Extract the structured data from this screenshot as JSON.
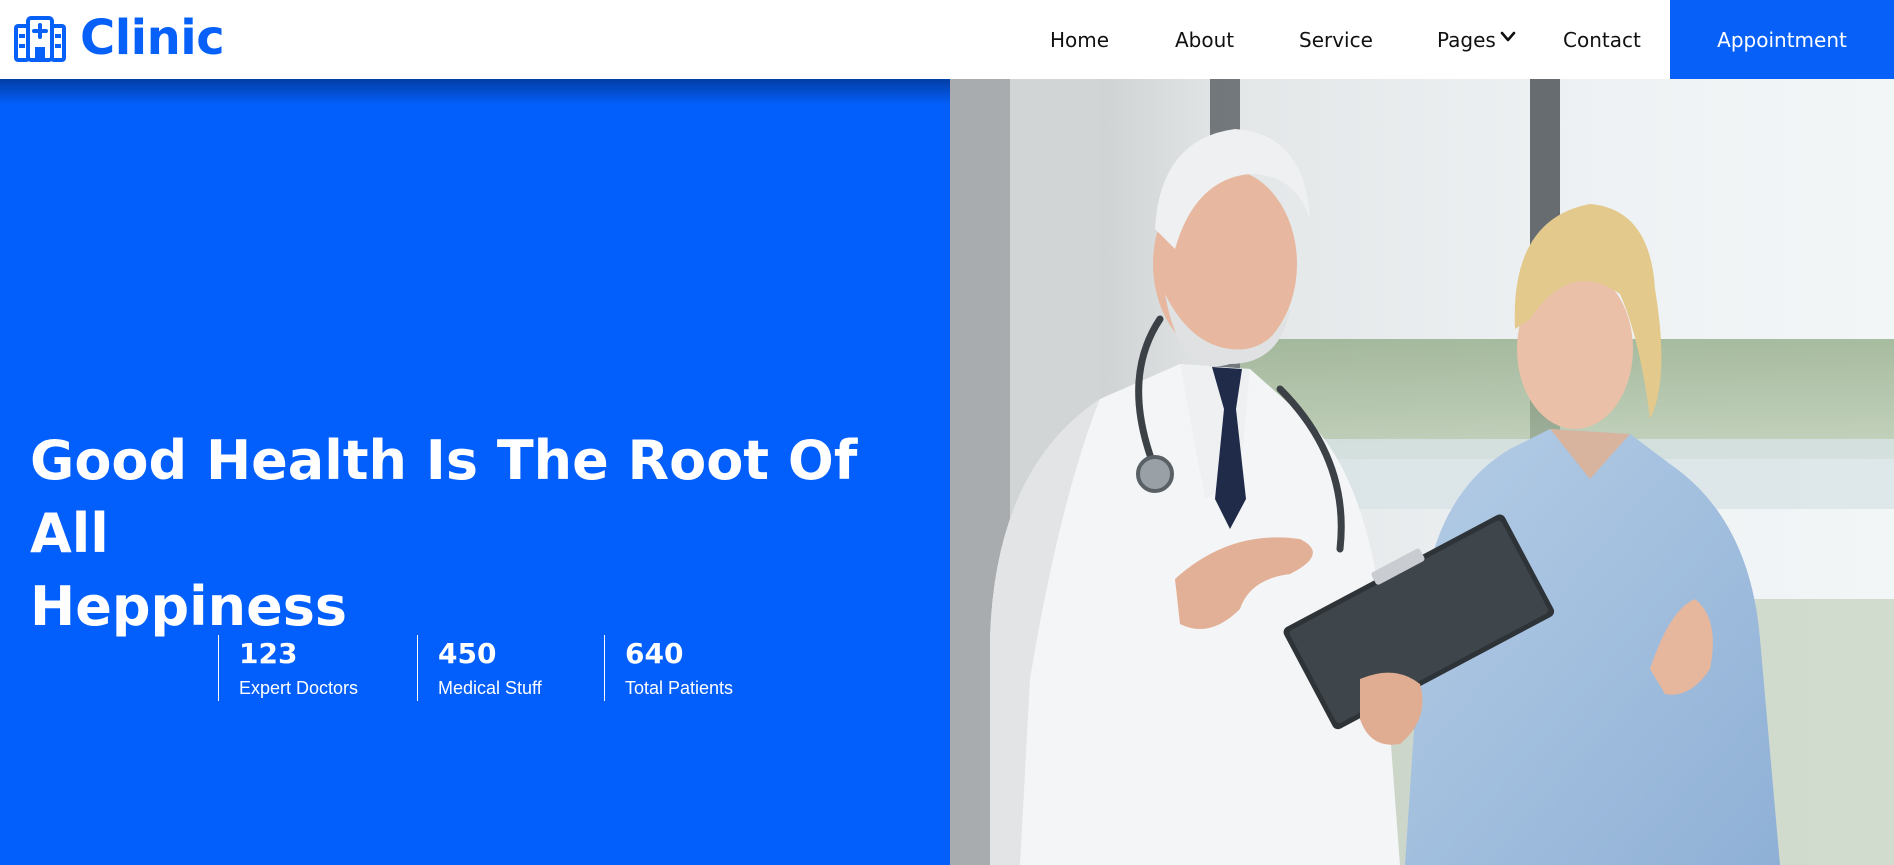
{
  "brand": {
    "name": "Clinic",
    "icon": "hospital-icon",
    "color": "#0761f9"
  },
  "nav": {
    "items": [
      {
        "label": "Home"
      },
      {
        "label": "About"
      },
      {
        "label": "Service"
      },
      {
        "label": "Pages",
        "icon": "chevron-down-icon"
      },
      {
        "label": "Contact"
      }
    ],
    "cta_label": "Appointment"
  },
  "hero": {
    "title": "Good Health Is The Root Of All\nHeppiness",
    "background_color": "#035ffc",
    "stats": [
      {
        "value": "123",
        "label": "Expert Doctors"
      },
      {
        "value": "450",
        "label": "Medical Stuff"
      },
      {
        "value": "640",
        "label": "Total Patients"
      }
    ],
    "image": "doctor-and-nurse-photo"
  }
}
